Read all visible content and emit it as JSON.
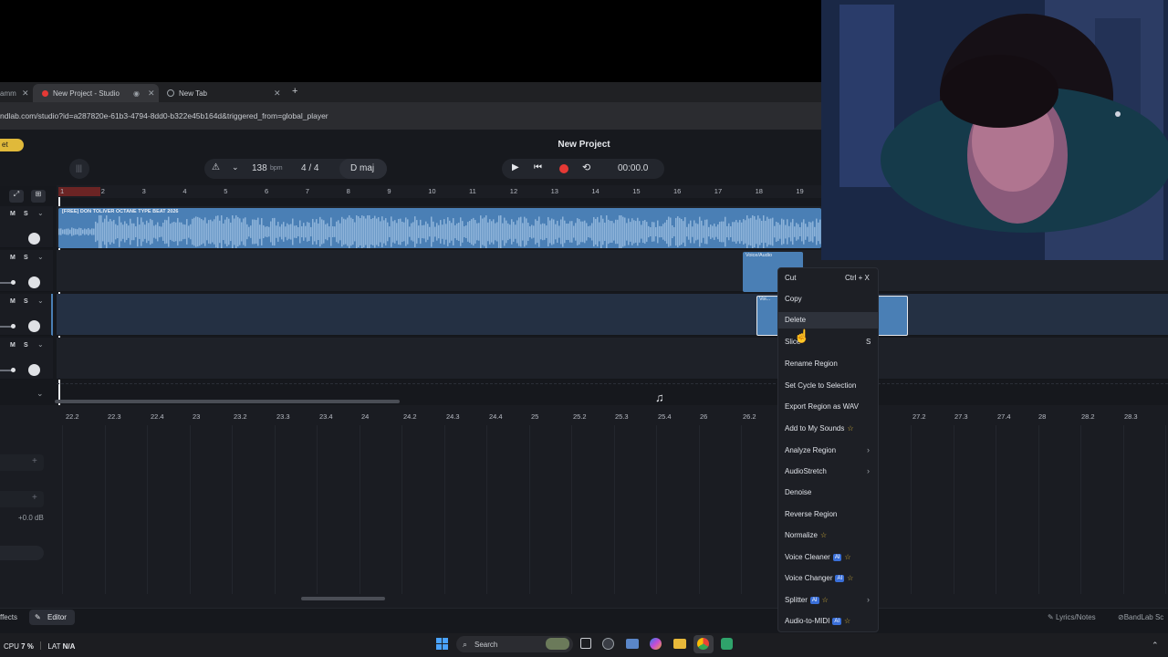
{
  "browser": {
    "tabs": [
      {
        "label": "amm"
      },
      {
        "label": "New Project - Studio"
      },
      {
        "label": "New Tab"
      }
    ],
    "url": "ndlab.com/studio?id=a287820e-61b3-4794-8dd0-b322e45b164d&triggered_from=global_player"
  },
  "toolbar": {
    "badge": "et",
    "project_title": "New Project",
    "tempo": "138",
    "tempo_unit": "bpm",
    "time_signature": "4 / 4",
    "key": "D maj",
    "time": "00:00.0"
  },
  "ruler_ticks": [
    "1",
    "2",
    "3",
    "4",
    "5",
    "6",
    "7",
    "8",
    "9",
    "10",
    "11",
    "12",
    "13",
    "14",
    "15",
    "16",
    "17",
    "18",
    "19"
  ],
  "tracks": {
    "ms_labels": {
      "mute": "M",
      "solo": "S"
    },
    "region_title": "[FREE] DON TOLIVER OCTANE TYPE BEAT 2026",
    "small_region_title": "Voice/Audio",
    "small_region_title_2": "Voi..."
  },
  "editor_ticks": [
    "22.2",
    "22.3",
    "22.4",
    "23",
    "23.2",
    "23.3",
    "23.4",
    "24",
    "24.2",
    "24.3",
    "24.4",
    "25",
    "25.2",
    "25.3",
    "25.4",
    "26",
    "26.2",
    "27.2",
    "27.3",
    "27.4",
    "28",
    "28.2",
    "28.3"
  ],
  "side_panel": {
    "gain": "+0.0 dB"
  },
  "context_menu": {
    "items": [
      {
        "label": "Cut",
        "shortcut": "Ctrl + X"
      },
      {
        "label": "Copy",
        "shortcut": ""
      },
      {
        "label": "Delete",
        "shortcut": ""
      },
      {
        "label": "Slice",
        "shortcut": "S"
      },
      {
        "label": "Rename Region",
        "shortcut": ""
      },
      {
        "label": "Set Cycle to Selection",
        "shortcut": ""
      },
      {
        "label": "Export Region as WAV",
        "shortcut": ""
      },
      {
        "label": "Add to My Sounds",
        "shortcut": ""
      },
      {
        "label": "Analyze Region",
        "shortcut": ""
      },
      {
        "label": "AudioStretch",
        "shortcut": ""
      },
      {
        "label": "Denoise",
        "shortcut": ""
      },
      {
        "label": "Reverse Region",
        "shortcut": ""
      },
      {
        "label": "Normalize",
        "shortcut": ""
      },
      {
        "label": "Voice Cleaner",
        "shortcut": ""
      },
      {
        "label": "Voice Changer",
        "shortcut": ""
      },
      {
        "label": "Splitter",
        "shortcut": ""
      },
      {
        "label": "Audio-to-MIDI",
        "shortcut": ""
      }
    ],
    "ai_badge": "AI"
  },
  "bottom_bar": {
    "effects": "ffects",
    "editor": "Editor",
    "lyrics": "Lyrics/Notes",
    "bandlab": "BandLab Sc"
  },
  "taskbar": {
    "cpu_label": "CPU",
    "cpu_value": "7 %",
    "lat_label": "LAT",
    "lat_value": "N/A",
    "search": "Search"
  },
  "colors": {
    "region_blue": "#4a7fb5",
    "accent_record": "#e53935",
    "ai_badge": "#3a6fd8",
    "premium_star": "#e0b93a"
  }
}
